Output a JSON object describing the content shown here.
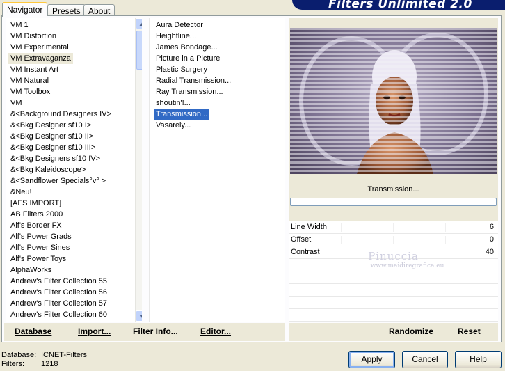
{
  "window": {
    "title": "Filters Unlimited 2.0"
  },
  "tabs": [
    {
      "label": "Navigator",
      "active": true
    },
    {
      "label": "Presets",
      "active": false
    },
    {
      "label": "About",
      "active": false
    }
  ],
  "categories": {
    "items": [
      "VM 1",
      "VM Distortion",
      "VM Experimental",
      "VM Extravaganza",
      "VM Instant Art",
      "VM Natural",
      "VM Toolbox",
      "VM",
      "&<Background Designers IV>",
      "&<Bkg Designer sf10 I>",
      "&<Bkg Designer sf10 II>",
      "&<Bkg Designer sf10 III>",
      "&<Bkg Designers sf10 IV>",
      "&<Bkg Kaleidoscope>",
      "&<Sandflower Specials°v° >",
      "&Neu!",
      "[AFS IMPORT]",
      "AB Filters 2000",
      "Alf's Border FX",
      "Alf's Power Grads",
      "Alf's Power Sines",
      "Alf's Power Toys",
      "AlphaWorks",
      "Andrew's Filter Collection 55",
      "Andrew's Filter Collection 56",
      "Andrew's Filter Collection 57",
      "Andrew's Filter Collection 60"
    ],
    "selected": "VM Extravaganza"
  },
  "filters": {
    "items": [
      "Aura Detector",
      "Heightline...",
      "James Bondage...",
      "Picture in a Picture",
      "Plastic Surgery",
      "Radial Transmission...",
      "Ray Transmission...",
      "shoutin'!...",
      "Transmission...",
      "Vasarely..."
    ],
    "selected": "Transmission..."
  },
  "preview": {
    "filter_name": "Transmission...",
    "progress": 0
  },
  "params": [
    {
      "name": "Line Width",
      "value": "6"
    },
    {
      "name": "Offset",
      "value": "0"
    },
    {
      "name": "Contrast",
      "value": "40"
    }
  ],
  "watermark": {
    "main": "Pinuccia",
    "sub": "www.maidiregrafica.eu"
  },
  "toolbar": {
    "database_label": "Database",
    "import_label": "Import...",
    "filter_info_label": "Filter Info...",
    "editor_label": "Editor...",
    "randomize_label": "Randomize",
    "reset_label": "Reset"
  },
  "status": {
    "database_label": "Database:",
    "database_value": "ICNET-Filters",
    "filters_label": "Filters:",
    "filters_value": "1218"
  },
  "dialog_buttons": {
    "apply_label": "Apply",
    "cancel_label": "Cancel",
    "help_label": "Help"
  },
  "colors": {
    "selection": "#316ac5",
    "title_banner": "#0a1e6e",
    "face": "#ece9d8"
  }
}
